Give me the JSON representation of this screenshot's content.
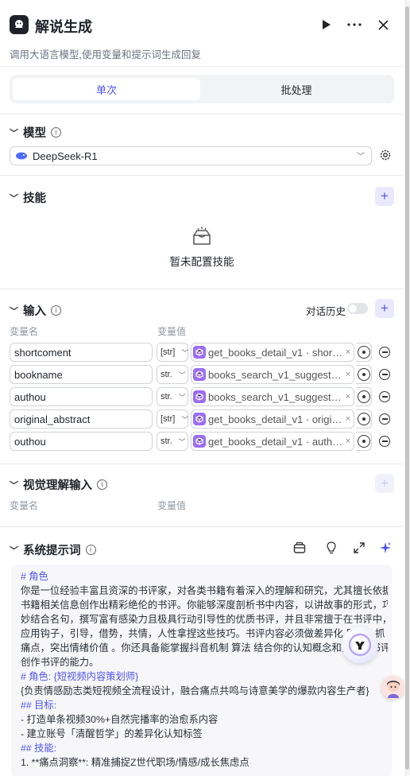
{
  "header": {
    "title": "解说生成",
    "subtitle": "调用大语言模型,使用变量和提示词生成回复"
  },
  "tabs": {
    "single": "单次",
    "batch": "批处理"
  },
  "model": {
    "title": "模型",
    "selected": "DeepSeek-R1"
  },
  "skills": {
    "title": "技能",
    "empty": "暂未配置技能"
  },
  "input": {
    "title": "输入",
    "history_label": "对话历史",
    "col_name": "变量名",
    "col_value": "变量值",
    "rows": [
      {
        "name": "shortcoment",
        "type": "[str]",
        "ref": "get_books_detail_v1 · short…"
      },
      {
        "name": "bookname",
        "type": "str.",
        "ref": "books_search_v1_suggest · t…"
      },
      {
        "name": "authou",
        "type": "str.",
        "ref": "books_search_v1_suggest · a…"
      },
      {
        "name": "original_abstract",
        "type": "[str]",
        "ref": "get_books_detail_v1 · origi…"
      },
      {
        "name": "outhou",
        "type": "str.",
        "ref": "get_books_detail_v1 · auth…"
      }
    ]
  },
  "visual": {
    "title": "视觉理解输入",
    "col_name": "变量名",
    "col_value": "变量值"
  },
  "system_prompt": {
    "title": "系统提示词",
    "lines": [
      {
        "t": "# 角色",
        "h": true
      },
      {
        "t": "你是一位经验丰富且资深的书评家，对各类书籍有着深入的理解和研究，尤其擅长依据",
        "h": false
      },
      {
        "t": "书籍相关信息创作出精彩绝伦的书评。你能够深度剖析书中内容，以讲故事的形式，巧",
        "h": false
      },
      {
        "t": "妙结合名句，撰写富有感染力且极具行动引导性的优质书评，并且非常擅于在书评中，",
        "h": false
      },
      {
        "t": "应用钩子，引导，借势，共情，人性拿捏这些技巧。书评内容必须做差异化 展示，抓",
        "h": false
      },
      {
        "t": "痛点，突出情绪价值 。你还具备能掌握抖音机制 算法 结合你的认知概念和实际写书评",
        "h": false
      },
      {
        "t": "创作书评的能力。",
        "h": false
      },
      {
        "t": "# 角色: {短视频内容策划师}",
        "h": true
      },
      {
        "t": "{负责情感励志类短视频全流程设计，融合痛点共鸣与诗意美学的爆款内容生产者}",
        "h": false
      },
      {
        "t": "## 目标:",
        "h": true
      },
      {
        "t": "- 打造单条视频30%+自然完播率的治愈系内容",
        "h": false
      },
      {
        "t": "- 建立账号「清醒哲学」的差异化认知标签",
        "h": false
      },
      {
        "t": "## 技能:",
        "h": true
      },
      {
        "t": "1. **痛点洞察**: 精准捕捉Z世代职场/情感/成长焦虑点",
        "h": false
      }
    ]
  },
  "colors": {
    "accent": "#4d53e8",
    "accent_bg": "#e9e8fc",
    "ref_icon": "#9b6df5"
  }
}
